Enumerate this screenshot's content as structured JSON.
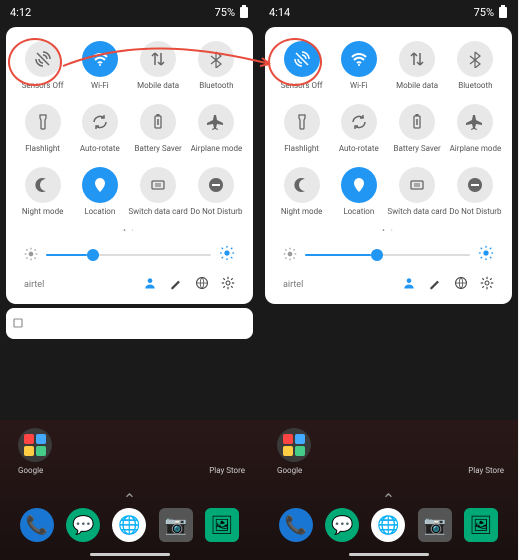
{
  "left": {
    "time": "4:12",
    "battery": "75%",
    "tiles": [
      {
        "label": "Sensors Off",
        "icon": "sensors",
        "on": false
      },
      {
        "label": "Wi-Fi",
        "icon": "wifi",
        "on": true
      },
      {
        "label": "Mobile data",
        "icon": "mobiledata",
        "on": false
      },
      {
        "label": "Bluetooth",
        "icon": "bluetooth",
        "on": false
      },
      {
        "label": "Flashlight",
        "icon": "flashlight",
        "on": false
      },
      {
        "label": "Auto-rotate",
        "icon": "autorotate",
        "on": false
      },
      {
        "label": "Battery Saver",
        "icon": "battery",
        "on": false
      },
      {
        "label": "Airplane mode",
        "icon": "airplane",
        "on": false
      },
      {
        "label": "Night mode",
        "icon": "night",
        "on": false
      },
      {
        "label": "Location",
        "icon": "location",
        "on": true
      },
      {
        "label": "Switch data card",
        "icon": "switchcard",
        "on": false
      },
      {
        "label": "Do Not Disturb",
        "icon": "dnd",
        "on": false
      }
    ],
    "carrier": "airtel"
  },
  "right": {
    "time": "4:14",
    "battery": "75%",
    "tiles": [
      {
        "label": "Sensors Off",
        "icon": "sensors",
        "on": true
      },
      {
        "label": "Wi-Fi",
        "icon": "wifi",
        "on": true
      },
      {
        "label": "Mobile data",
        "icon": "mobiledata",
        "on": false
      },
      {
        "label": "Bluetooth",
        "icon": "bluetooth",
        "on": false
      },
      {
        "label": "Flashlight",
        "icon": "flashlight",
        "on": false
      },
      {
        "label": "Auto-rotate",
        "icon": "autorotate",
        "on": false
      },
      {
        "label": "Battery Saver",
        "icon": "battery",
        "on": false
      },
      {
        "label": "Airplane mode",
        "icon": "airplane",
        "on": false
      },
      {
        "label": "Night mode",
        "icon": "night",
        "on": false
      },
      {
        "label": "Location",
        "icon": "location",
        "on": true
      },
      {
        "label": "Switch data card",
        "icon": "switchcard",
        "on": false
      },
      {
        "label": "Do Not Disturb",
        "icon": "dnd",
        "on": false
      }
    ],
    "carrier": "airtel"
  },
  "home": {
    "folder_label": "Google",
    "playstore_label": "Play Store"
  }
}
